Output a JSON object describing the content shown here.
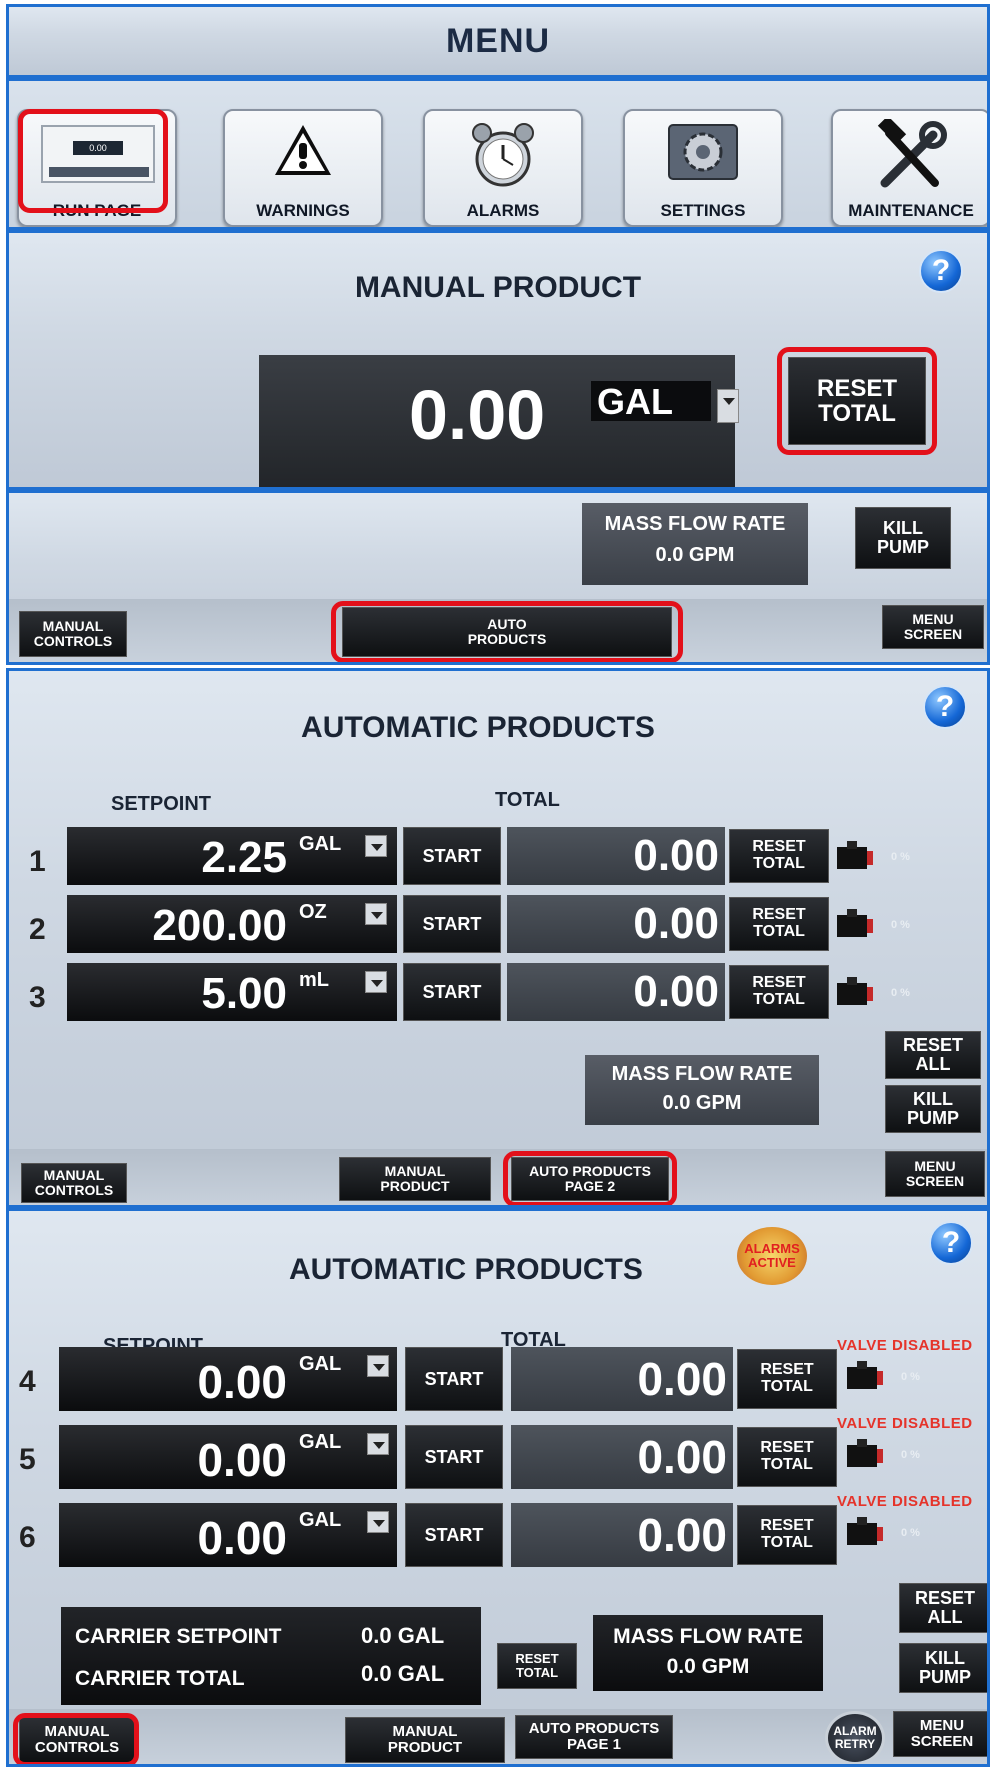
{
  "menu": {
    "title": "MENU"
  },
  "menu_icons": [
    {
      "label": "RUN PAGE"
    },
    {
      "label": "WARNINGS"
    },
    {
      "label": "ALARMS"
    },
    {
      "label": "SETTINGS"
    },
    {
      "label": "MAINTENANCE"
    }
  ],
  "run_icon_readout": "0.00",
  "manual": {
    "title": "MANUAL PRODUCT",
    "help": "?",
    "total_value": "0.00",
    "unit": "GAL",
    "reset_total": "RESET\nTOTAL",
    "mass_flow_label": "MASS FLOW RATE",
    "mass_flow_value": "0.0  GPM",
    "kill_pump": "KILL\nPUMP",
    "manual_controls": "MANUAL\nCONTROLS",
    "auto_products": "AUTO\nPRODUCTS",
    "menu_screen": "MENU\nSCREEN"
  },
  "auto1": {
    "title": "AUTOMATIC PRODUCTS",
    "help": "?",
    "setpoint_header": "SETPOINT",
    "total_header": "TOTAL",
    "rows": [
      {
        "num": "1",
        "setpoint": "2.25",
        "unit": "GAL",
        "start": "START",
        "total": "0.00",
        "reset": "RESET\nTOTAL",
        "pct": "0 %"
      },
      {
        "num": "2",
        "setpoint": "200.00",
        "unit": "OZ",
        "start": "START",
        "total": "0.00",
        "reset": "RESET\nTOTAL",
        "pct": "0 %"
      },
      {
        "num": "3",
        "setpoint": "5.00",
        "unit": "mL",
        "start": "START",
        "total": "0.00",
        "reset": "RESET\nTOTAL",
        "pct": "0 %"
      }
    ],
    "reset_all": "RESET\nALL",
    "mass_flow_label": "MASS FLOW RATE",
    "mass_flow_value": "0.0  GPM",
    "kill_pump": "KILL\nPUMP",
    "manual_controls": "MANUAL\nCONTROLS",
    "manual_product": "MANUAL\nPRODUCT",
    "auto_products_page2": "AUTO PRODUCTS\nPAGE 2",
    "menu_screen": "MENU\nSCREEN"
  },
  "auto2": {
    "title": "AUTOMATIC PRODUCTS",
    "alarms_badge": "ALARMS\nACTIVE",
    "help": "?",
    "setpoint_header": "SETPOINT",
    "total_header": "TOTAL",
    "rows": [
      {
        "num": "4",
        "setpoint": "0.00",
        "unit": "GAL",
        "start": "START",
        "total": "0.00",
        "reset": "RESET\nTOTAL",
        "pct": "0 %",
        "status": "VALVE DISABLED"
      },
      {
        "num": "5",
        "setpoint": "0.00",
        "unit": "GAL",
        "start": "START",
        "total": "0.00",
        "reset": "RESET\nTOTAL",
        "pct": "0 %",
        "status": "VALVE DISABLED"
      },
      {
        "num": "6",
        "setpoint": "0.00",
        "unit": "GAL",
        "start": "START",
        "total": "0.00",
        "reset": "RESET\nTOTAL",
        "pct": "0 %",
        "status": "VALVE DISABLED"
      }
    ],
    "carrier_setpoint_label": "CARRIER SETPOINT",
    "carrier_setpoint_value": "0.0 GAL",
    "carrier_total_label": "CARRIER TOTAL",
    "carrier_total_value": "0.0 GAL",
    "carrier_reset": "RESET\nTOTAL",
    "mass_flow_label": "MASS FLOW RATE",
    "mass_flow_value": "0.0  GPM",
    "reset_all": "RESET\nALL",
    "kill_pump": "KILL\nPUMP",
    "manual_controls": "MANUAL\nCONTROLS",
    "manual_product": "MANUAL\nPRODUCT",
    "auto_products_page1": "AUTO PRODUCTS\nPAGE 1",
    "alarm_retry": "ALARM\nRETRY",
    "menu_screen": "MENU\nSCREEN"
  },
  "colors": {
    "highlight": "#e3101a",
    "panel_border": "#1f6fd0",
    "disabled_text": "#e5332a"
  }
}
